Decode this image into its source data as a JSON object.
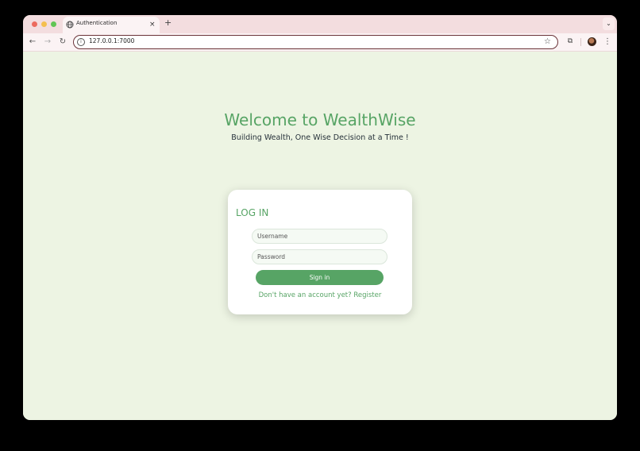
{
  "browser": {
    "tab_title": "Authentication",
    "tab_close": "×",
    "new_tab": "+",
    "tabs_menu": "⌄",
    "back": "←",
    "forward": "→",
    "reload": "↻",
    "url": "127.0.0.1:7000",
    "bookmark": "☆",
    "extensions": "⧉",
    "menu": "⋮"
  },
  "page": {
    "headline": "Welcome to WealthWise",
    "tagline": "Building Wealth, One Wise Decision at a Time !"
  },
  "login": {
    "title": "LOG IN",
    "username_placeholder": "Username",
    "password_placeholder": "Password",
    "sign_in_label": "Sign in",
    "register_link": "Don't have an account yet? Register"
  },
  "colors": {
    "accent": "#57a465",
    "background": "#edf4e3"
  }
}
